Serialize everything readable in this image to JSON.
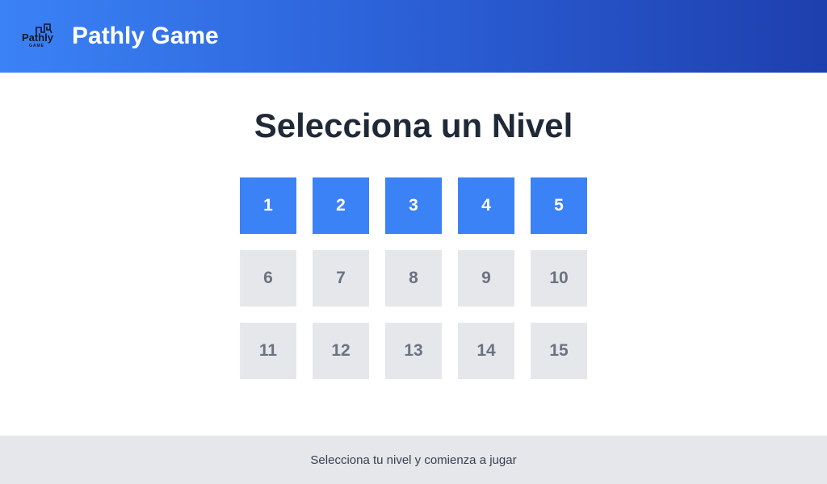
{
  "header": {
    "title": "Pathly Game",
    "logo_text": "Pathly",
    "logo_subtext": "GAME",
    "logo_icon": "spiral-path-logo",
    "gradient_colors": [
      "#3b82f6",
      "#1e3fae"
    ]
  },
  "main": {
    "title": "Selecciona un Nivel",
    "levels": [
      {
        "label": "1",
        "state": "unlocked"
      },
      {
        "label": "2",
        "state": "unlocked"
      },
      {
        "label": "3",
        "state": "unlocked"
      },
      {
        "label": "4",
        "state": "unlocked"
      },
      {
        "label": "5",
        "state": "unlocked"
      },
      {
        "label": "6",
        "state": "locked"
      },
      {
        "label": "7",
        "state": "locked"
      },
      {
        "label": "8",
        "state": "locked"
      },
      {
        "label": "9",
        "state": "locked"
      },
      {
        "label": "10",
        "state": "locked"
      },
      {
        "label": "11",
        "state": "locked"
      },
      {
        "label": "12",
        "state": "locked"
      },
      {
        "label": "13",
        "state": "locked"
      },
      {
        "label": "14",
        "state": "locked"
      },
      {
        "label": "15",
        "state": "locked"
      }
    ]
  },
  "footer": {
    "text": "Selecciona tu nivel y comienza a jugar"
  },
  "colors": {
    "unlocked_bg": "#3b82f6",
    "locked_bg": "#e5e7eb",
    "title_text": "#1f2937"
  }
}
